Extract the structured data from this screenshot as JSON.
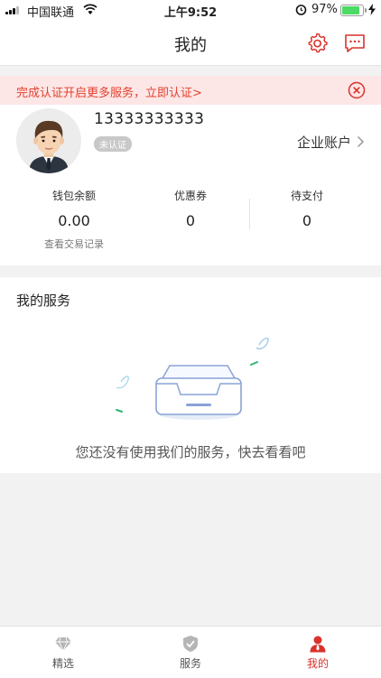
{
  "status_bar": {
    "carrier": "中国联通",
    "time": "上午9:52",
    "battery": "97%",
    "battery_level": 0.97
  },
  "nav": {
    "title": "我的",
    "settings_icon": "gear-icon",
    "message_icon": "chat-icon"
  },
  "banner": {
    "text": "完成认证开启更多服务，立即认证>",
    "close_icon": "close-circle-icon"
  },
  "profile": {
    "phone": "13333333333",
    "verify_status": "未认证",
    "enterprise_label": "企业账户",
    "stats": [
      {
        "label": "钱包余额",
        "value": "0.00"
      },
      {
        "label": "优惠券",
        "value": "0"
      },
      {
        "label": "待支付",
        "value": "0"
      }
    ],
    "transaction_link": "查看交易记录"
  },
  "services": {
    "title": "我的服务",
    "empty_text": "您还没有使用我们的服务，快去看看吧"
  },
  "tabbar": {
    "tabs": [
      {
        "label": "精选",
        "icon": "diamond-icon"
      },
      {
        "label": "服务",
        "icon": "shield-icon"
      },
      {
        "label": "我的",
        "icon": "user-icon"
      }
    ],
    "active_index": 2
  },
  "colors": {
    "accent": "#d9322b",
    "banner_bg": "#fde6e6",
    "banner_text": "#e2422f",
    "background": "#f2f2f2"
  }
}
